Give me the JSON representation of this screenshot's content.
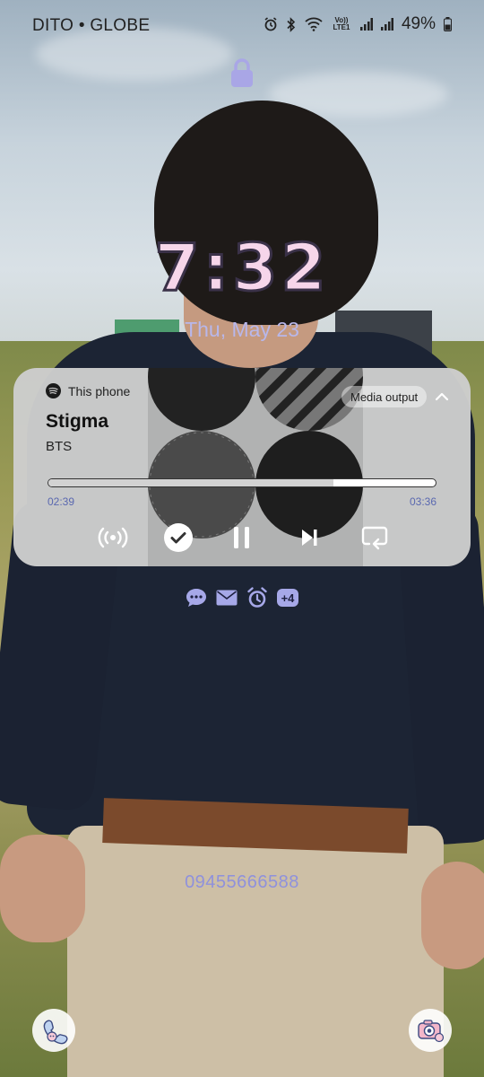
{
  "status_bar": {
    "carrier": "DITO • GLOBE",
    "battery": "49%",
    "icons": [
      "alarm-icon",
      "bluetooth-icon",
      "wifi-icon",
      "volte-icon",
      "signal-icon",
      "signal-icon",
      "battery-icon"
    ],
    "volte_label": "Vo)) LTE1"
  },
  "lock_icon": "lock-icon",
  "clock": {
    "time": "7:32",
    "date": "Thu, May 23"
  },
  "media": {
    "source": "This phone",
    "source_icon": "spotify-icon",
    "output_label": "Media output",
    "title": "Stigma",
    "artist": "BTS",
    "elapsed": "02:39",
    "duration": "03:36",
    "progress": 0.736,
    "controls": [
      "cast-icon",
      "liked-check-icon",
      "pause-icon",
      "skip-next-icon",
      "repeat-icon"
    ]
  },
  "notifications": {
    "icons": [
      "messages-icon",
      "mail-icon",
      "alarm-icon"
    ],
    "more": "+4"
  },
  "phone_number": "09455666588",
  "shortcuts": {
    "left": "phone-shortcut-icon",
    "right": "camera-shortcut-icon"
  },
  "colors": {
    "accent": "#a6a8e8",
    "date_text": "#b8b7ea",
    "phone_text": "#8f91dc"
  }
}
